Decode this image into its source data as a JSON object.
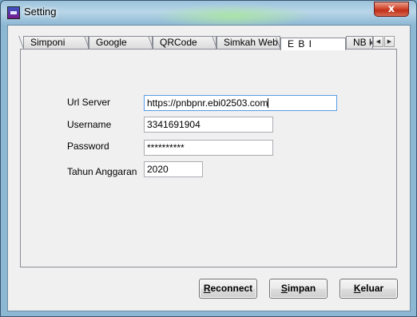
{
  "window": {
    "title": "Setting",
    "close_label": "x"
  },
  "app_icon": {
    "label": "eba"
  },
  "tabs": [
    {
      "label": "Simponi"
    },
    {
      "label": "Google Drive"
    },
    {
      "label": "QRCode"
    },
    {
      "label": "Simkah Web"
    },
    {
      "label": "E B I"
    },
    {
      "label": "NB k"
    }
  ],
  "active_tab": "E B I",
  "tab_scroll": {
    "left": "◀",
    "right": "▶"
  },
  "form": {
    "url_label": "Url Server",
    "url_value": "https://pnbpnr.ebi02503.com",
    "username_label": "Username",
    "username_value": "3341691904",
    "password_label": "Password",
    "password_value": "**********",
    "tahun_label": "Tahun Anggaran",
    "tahun_value": "2020"
  },
  "buttons": {
    "reconnect": {
      "first": "R",
      "rest": "econnect"
    },
    "simpan": {
      "first": "S",
      "rest": "impan"
    },
    "keluar": {
      "first": "K",
      "rest": "eluar"
    }
  }
}
